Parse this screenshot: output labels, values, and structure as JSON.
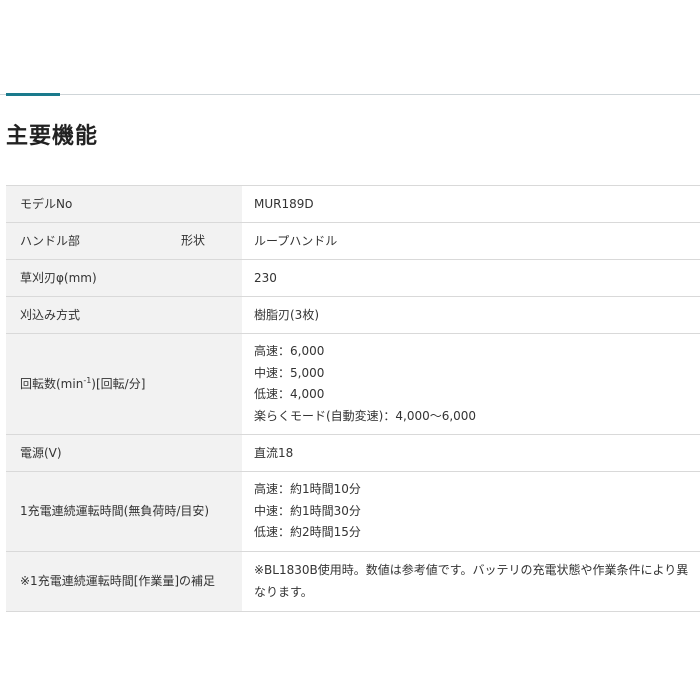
{
  "header": {
    "title": "主要機能"
  },
  "spec_rows": [
    {
      "label": "モデルNo",
      "value": "MUR189D"
    },
    {
      "label": "ハンドル部",
      "sublabel": "形状",
      "value": "ループハンドル"
    },
    {
      "label": "草刈刃φ(mm)",
      "value": "230"
    },
    {
      "label": "刈込み方式",
      "value": "樹脂刃(3枚)"
    },
    {
      "label_prefix": "回転数(min",
      "label_sup": "-1",
      "label_suffix": ")[回転/分]",
      "values": [
        "高速：6,000",
        "中速：5,000",
        "低速：4,000",
        "楽らくモード(自動変速)：4,000〜6,000"
      ]
    },
    {
      "label": "電源(V)",
      "value": "直流18"
    },
    {
      "label": "1充電連続運転時間(無負荷時/目安)",
      "values": [
        "高速：約1時間10分",
        "中速：約1時間30分",
        "低速：約2時間15分"
      ]
    },
    {
      "label": "※1充電連続運転時間[作業量]の補足",
      "value": "※BL1830B使用時。数値は参考値です。バッテリの充電状態や作業条件により異なります。"
    }
  ],
  "colors": {
    "accent": "#1a7a8c",
    "label_bg": "#f2f2f2",
    "border": "#d9d9d9"
  }
}
